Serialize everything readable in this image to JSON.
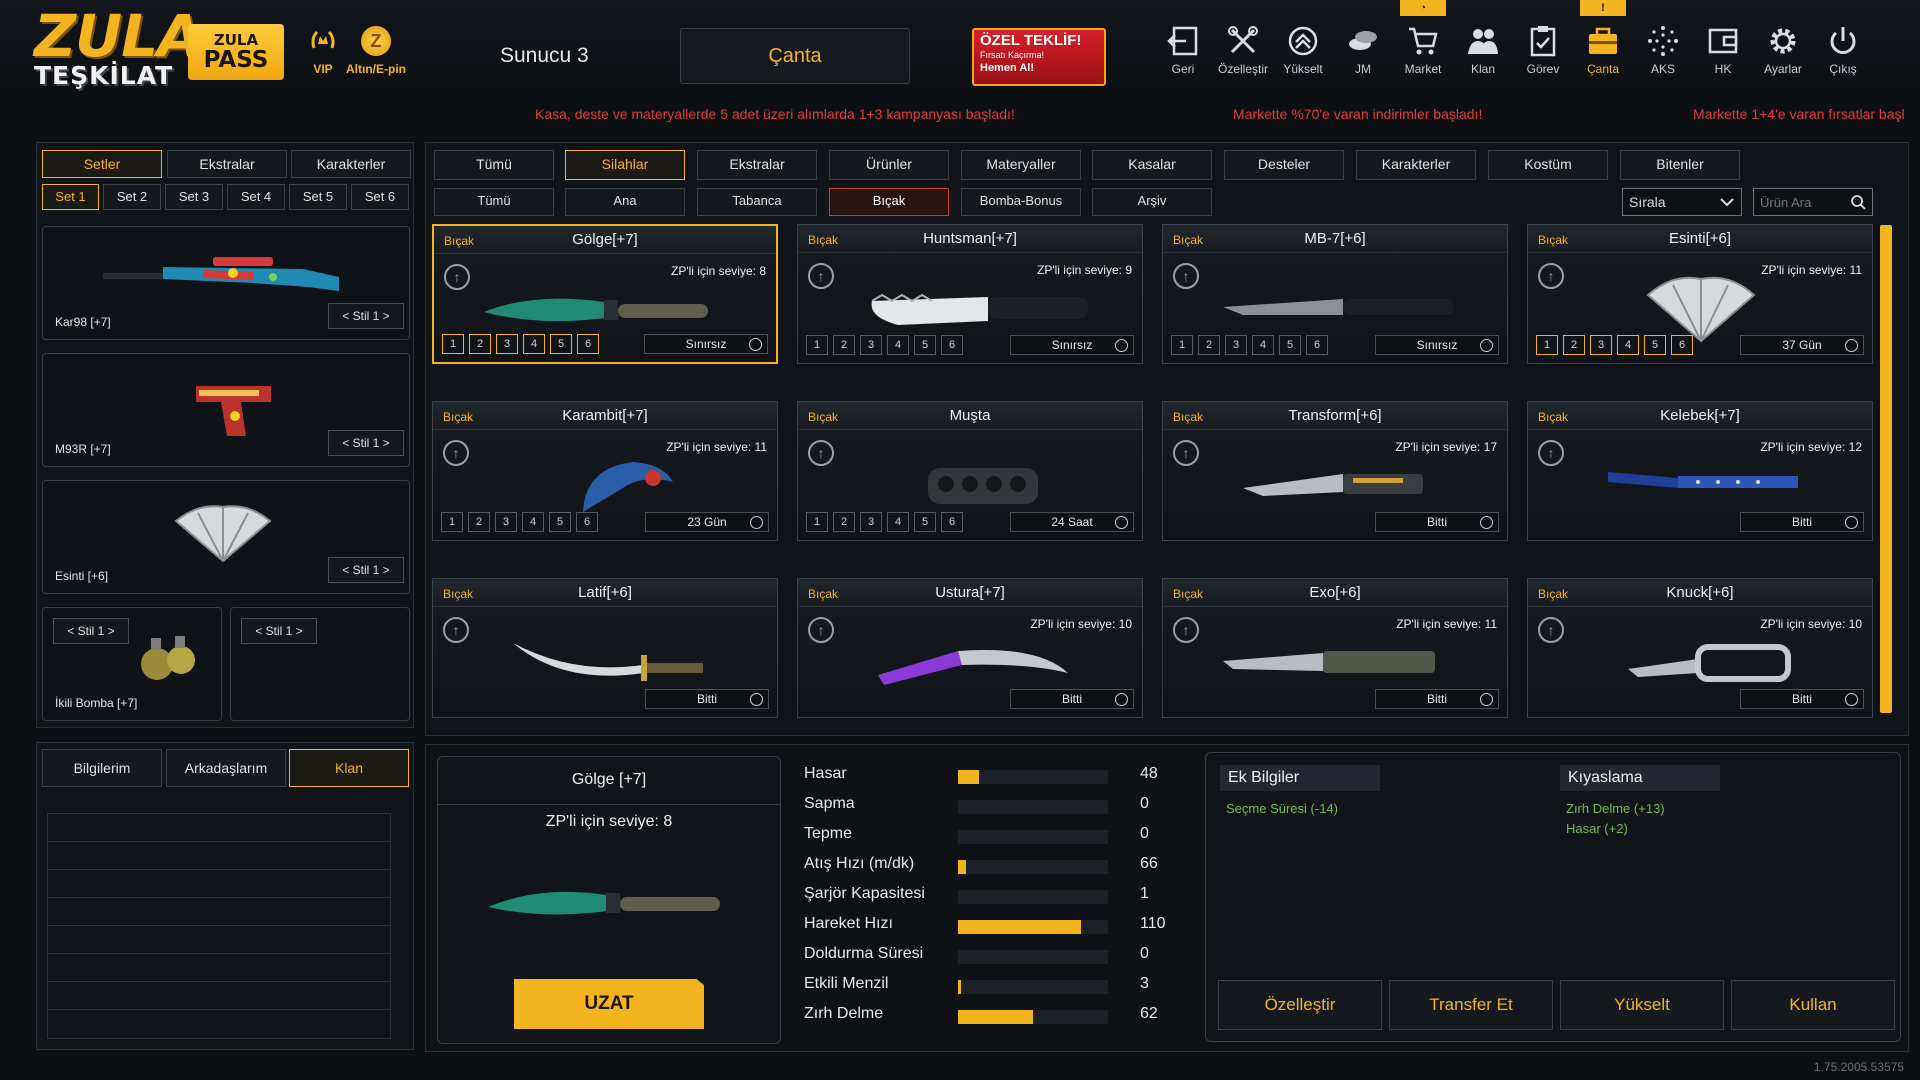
{
  "header": {
    "logo_line1": "ZULA",
    "logo_line2": "TEŞKİLAT",
    "pass_line1": "ZULA",
    "pass_line2": "PASS",
    "vip": "VIP",
    "gold": "Altın/E-pin",
    "server": "Sunucu 3",
    "bag_tab": "Çanta",
    "offer_title": "ÖZEL TEKLİF!",
    "offer_sub": "Fırsatı Kaçırma!",
    "offer_cta": "Hemen Al!",
    "nav": [
      {
        "label": "Geri",
        "icon": "back-icon"
      },
      {
        "label": "Özelleştir",
        "icon": "tools-icon"
      },
      {
        "label": "Yükselt",
        "icon": "upgrade-icon"
      },
      {
        "label": "JM",
        "icon": "coins-icon"
      },
      {
        "label": "Market",
        "icon": "cart-icon"
      },
      {
        "label": "Klan",
        "icon": "clan-icon"
      },
      {
        "label": "Görev",
        "icon": "clipboard-icon"
      },
      {
        "label": "Çanta",
        "icon": "bag-icon"
      },
      {
        "label": "AKS",
        "icon": "sparkle-icon"
      },
      {
        "label": "HK",
        "icon": "wallet-icon"
      },
      {
        "label": "Ayarlar",
        "icon": "gear-icon"
      },
      {
        "label": "Çıkış",
        "icon": "power-icon"
      }
    ],
    "badge_market": "◔",
    "badge_canta": "!"
  },
  "ticker": {
    "msg1": "Kasa, deste ve materyallerde 5 adet üzeri alımlarda 1+3 kampanyası başladı!",
    "msg2": "Markette %70'e varan indirimler başladı!",
    "msg3": "Markette 1+4'e varan fırsatlar başl"
  },
  "left": {
    "tabs": [
      "Setler",
      "Ekstralar",
      "Karakterler"
    ],
    "sets": [
      "Set 1",
      "Set 2",
      "Set 3",
      "Set 4",
      "Set 5",
      "Set 6"
    ],
    "items": [
      {
        "name": "Kar98 [+7]",
        "stil": "Stil 1"
      },
      {
        "name": "M93R [+7]",
        "stil": "Stil 1"
      },
      {
        "name": "Esinti [+6]",
        "stil": "Stil 1"
      },
      {
        "name": "İkili Bomba [+7]",
        "stil": "Stil 1"
      },
      {
        "name": "",
        "stil": "Stil 1"
      }
    ],
    "social_tabs": [
      "Bilgilerim",
      "Arkadaşlarım",
      "Klan"
    ]
  },
  "filters": {
    "main": [
      "Tümü",
      "Silahlar",
      "Ekstralar",
      "Ürünler",
      "Materyaller",
      "Kasalar",
      "Desteler",
      "Karakterler",
      "Kostüm",
      "Bitenler"
    ],
    "sub": [
      "Tümü",
      "Ana",
      "Tabanca",
      "Bıçak",
      "Bomba-Bonus",
      "Arşiv"
    ],
    "sort": "Sırala",
    "search_placeholder": "Ürün Ara"
  },
  "cards": [
    {
      "cat": "Bıçak",
      "title": "Gölge[+7]",
      "level": "ZP'li için seviye: 8",
      "dur": "Sınırsız",
      "slots": [
        "1",
        "2",
        "3",
        "4",
        "5",
        "6"
      ]
    },
    {
      "cat": "Bıçak",
      "title": "Huntsman[+7]",
      "level": "ZP'li için seviye: 9",
      "dur": "Sınırsız",
      "slots": [
        "1",
        "2",
        "3",
        "4",
        "5",
        "6"
      ]
    },
    {
      "cat": "Bıçak",
      "title": "MB-7[+6]",
      "level": "",
      "dur": "Sınırsız",
      "slots": [
        "1",
        "2",
        "3",
        "4",
        "5",
        "6"
      ]
    },
    {
      "cat": "Bıçak",
      "title": "Esinti[+6]",
      "level": "ZP'li için seviye: 11",
      "dur": "37 Gün",
      "slots": [
        "1",
        "2",
        "3",
        "4",
        "5",
        "6"
      ]
    },
    {
      "cat": "Bıçak",
      "title": "Karambit[+7]",
      "level": "ZP'li için seviye: 11",
      "dur": "23 Gün",
      "slots": [
        "1",
        "2",
        "3",
        "4",
        "5",
        "6"
      ]
    },
    {
      "cat": "Bıçak",
      "title": "Muşta",
      "level": "",
      "dur": "24 Saat",
      "slots": [
        "1",
        "2",
        "3",
        "4",
        "5",
        "6"
      ]
    },
    {
      "cat": "Bıçak",
      "title": "Transform[+6]",
      "level": "ZP'li için seviye: 17",
      "dur": "Bitti",
      "slots": []
    },
    {
      "cat": "Bıçak",
      "title": "Kelebek[+7]",
      "level": "ZP'li için seviye: 12",
      "dur": "Bitti",
      "slots": []
    },
    {
      "cat": "Bıçak",
      "title": "Latif[+6]",
      "level": "",
      "dur": "Bitti",
      "slots": []
    },
    {
      "cat": "Bıçak",
      "title": "Ustura[+7]",
      "level": "ZP'li için seviye: 10",
      "dur": "Bitti",
      "slots": []
    },
    {
      "cat": "Bıçak",
      "title": "Exo[+6]",
      "level": "ZP'li için seviye: 11",
      "dur": "Bitti",
      "slots": []
    },
    {
      "cat": "Bıçak",
      "title": "Knuck[+6]",
      "level": "ZP'li için seviye: 10",
      "dur": "Bitti",
      "slots": []
    }
  ],
  "detail": {
    "title": "Gölge [+7]",
    "level": "ZP'li için seviye: 8",
    "extend": "UZAT"
  },
  "stats": [
    {
      "label": "Hasar",
      "value": "48",
      "pct": 0.14
    },
    {
      "label": "Sapma",
      "value": "0",
      "pct": 0
    },
    {
      "label": "Tepme",
      "value": "0",
      "pct": 0
    },
    {
      "label": "Atış Hızı (m/dk)",
      "value": "66",
      "pct": 0.05
    },
    {
      "label": "Şarjör Kapasitesi",
      "value": "1",
      "pct": 0
    },
    {
      "label": "Hareket Hızı",
      "value": "110",
      "pct": 0.82
    },
    {
      "label": "Doldurma Süresi",
      "value": "0",
      "pct": 0
    },
    {
      "label": "Etkili Menzil",
      "value": "3",
      "pct": 0.02
    },
    {
      "label": "Zırh Delme",
      "value": "62",
      "pct": 0.5
    }
  ],
  "info": {
    "extra_title": "Ek Bilgiler",
    "extra_lines": [
      "Seçme Süresi (-14)"
    ],
    "compare_title": "Kıyaslama",
    "compare_lines": [
      "Zırh Delme (+13)",
      "Hasar (+2)"
    ],
    "actions": [
      "Özelleştir",
      "Transfer Et",
      "Yükselt",
      "Kullan"
    ]
  },
  "version": "1.75.2005.53575",
  "colors": {
    "accent": "#f4b41f",
    "red": "#e23a36",
    "green": "#6fbf4a"
  }
}
